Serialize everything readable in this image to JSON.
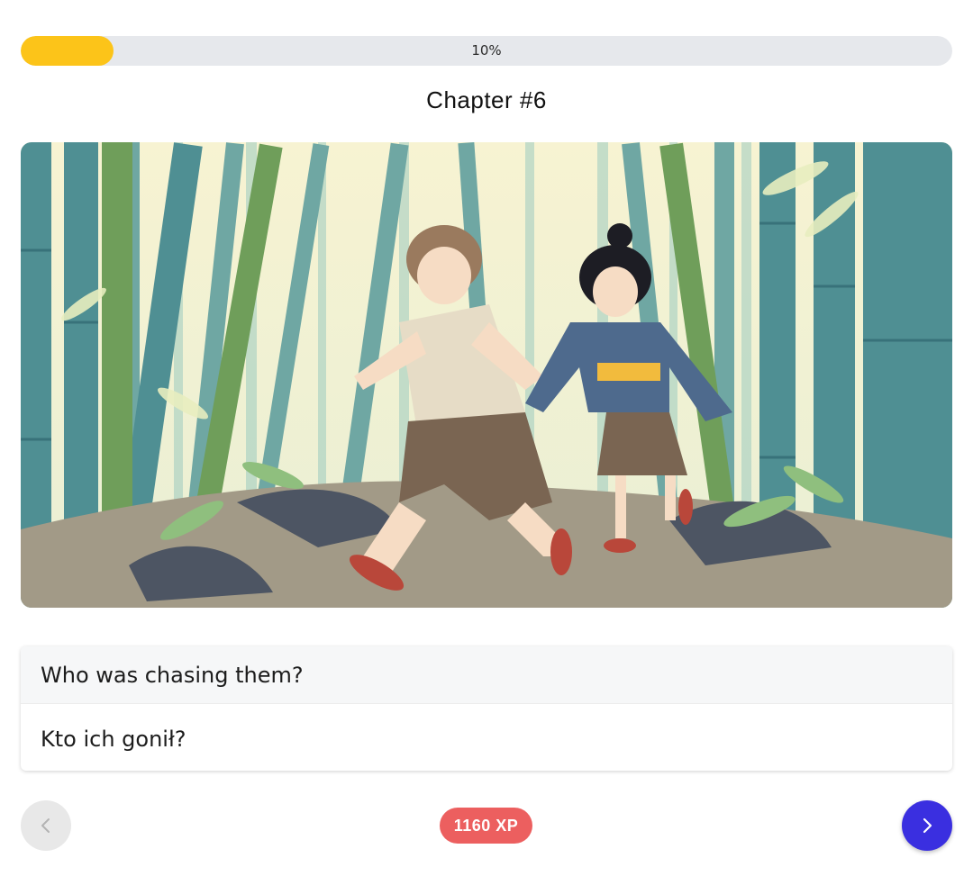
{
  "progress": {
    "label": "10%",
    "value": 0.1,
    "fill_color": "#fcc419",
    "track_color": "#e6e8ec"
  },
  "chapter": {
    "title": "Chapter #6"
  },
  "illustration": {
    "subject": "two-children-running-through-bamboo-forest"
  },
  "question": {
    "text": "Who was chasing them?",
    "translation": "Kto ich gonił?"
  },
  "navigation": {
    "prev_icon": "chevron-left-icon",
    "next_icon": "chevron-right-icon",
    "next_color": "#3a2fe0"
  },
  "xp": {
    "label": "1160 XP",
    "color": "#ec5f5f"
  }
}
